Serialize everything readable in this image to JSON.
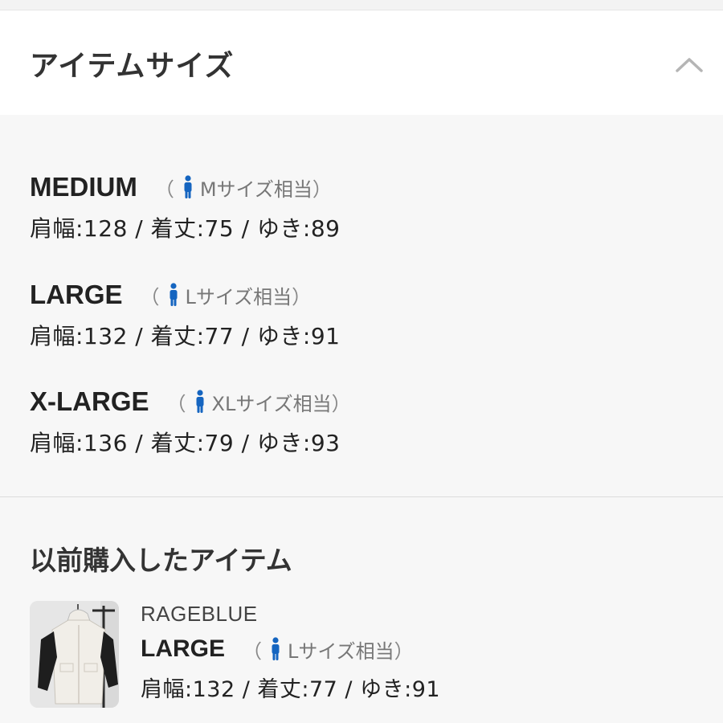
{
  "section": {
    "title": "アイテムサイズ",
    "collapse_icon": "chevron-up-icon"
  },
  "sizes": [
    {
      "name": "MEDIUM",
      "paren_open": "（",
      "equivalent": "Mサイズ相当",
      "paren_close": "）",
      "measurements": "肩幅:128 / 着丈:75 / ゆき:89"
    },
    {
      "name": "LARGE",
      "paren_open": "（",
      "equivalent": "Lサイズ相当",
      "paren_close": "）",
      "measurements": "肩幅:132 / 着丈:77 / ゆき:91"
    },
    {
      "name": "X-LARGE",
      "paren_open": "（",
      "equivalent": "XLサイズ相当",
      "paren_close": "）",
      "measurements": "肩幅:136 / 着丈:79 / ゆき:93"
    }
  ],
  "previous": {
    "title": "以前購入したアイテム",
    "item": {
      "brand": "RAGEBLUE",
      "size": "LARGE",
      "paren_open": "（",
      "equivalent": "Lサイズ相当",
      "paren_close": "）",
      "measurements": "肩幅:132 / 着丈:77 / ゆき:91"
    }
  },
  "colors": {
    "person_icon": "#1565c0",
    "background": "#f7f7f7",
    "header_background": "#ffffff"
  },
  "icons": {
    "person": "person-icon",
    "thumbnail": "jacket-thumbnail"
  }
}
